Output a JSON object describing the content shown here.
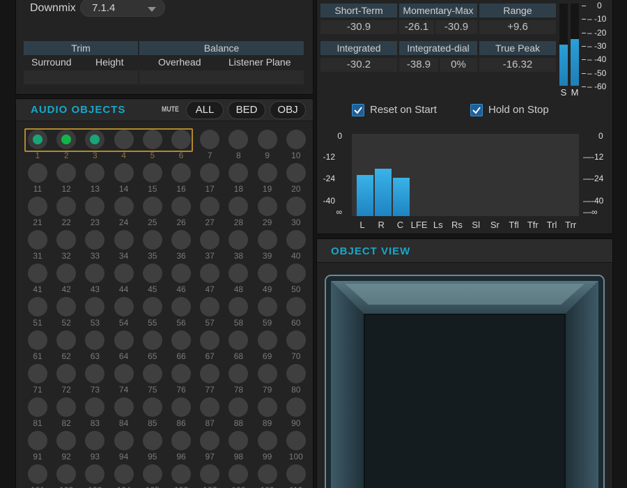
{
  "downmix": {
    "label": "Downmix",
    "value": "7.1.4"
  },
  "trim_balance": {
    "headers": [
      "Trim",
      "Balance"
    ],
    "subheaders": [
      "Surround",
      "Height",
      "Overhead",
      "Listener Plane"
    ]
  },
  "audio_objects": {
    "title": "AUDIO OBJECTS",
    "mute_label": "MUTE",
    "buttons": [
      "ALL",
      "BED",
      "OBJ"
    ],
    "active_objects": [
      1,
      2,
      3
    ],
    "selected_range": [
      1,
      6
    ]
  },
  "loudness": {
    "headers1": [
      "Short-Term",
      "Momentary-Max",
      "Range"
    ],
    "values1": [
      "-30.9",
      "-26.1",
      "-30.9",
      "+9.6"
    ],
    "headers2": [
      "Integrated",
      "Integrated-dial",
      "True Peak"
    ],
    "values2": [
      "-30.2",
      "-38.9",
      "0%",
      "-16.32"
    ],
    "meter_scale": [
      "0",
      "-10",
      "-20",
      "-30",
      "-40",
      "-50",
      "-60"
    ],
    "meters": [
      {
        "label": "S",
        "level": 0.5
      },
      {
        "label": "M",
        "level": 0.57
      }
    ]
  },
  "options": {
    "reset_on_start": {
      "label": "Reset on Start",
      "checked": true
    },
    "hold_on_stop": {
      "label": "Hold on Stop",
      "checked": true
    }
  },
  "channel_meter": {
    "scale": [
      "0",
      "-12",
      "-24",
      "-40",
      "∞"
    ],
    "channels": [
      "L",
      "R",
      "C",
      "LFE",
      "Ls",
      "Rs",
      "Sl",
      "Sr",
      "Tfl",
      "Tfr",
      "Trl",
      "Trr"
    ],
    "levels": [
      0.5,
      0.58,
      0.47,
      0,
      0,
      0,
      0,
      0,
      0,
      0,
      0,
      0
    ]
  },
  "object_view": {
    "title": "OBJECT VIEW"
  },
  "colors": {
    "accent": "#17a7c9",
    "active_green": "#12b54a",
    "meter_blue": "#2a9fd8",
    "selection_gold": "#b08a2a"
  }
}
